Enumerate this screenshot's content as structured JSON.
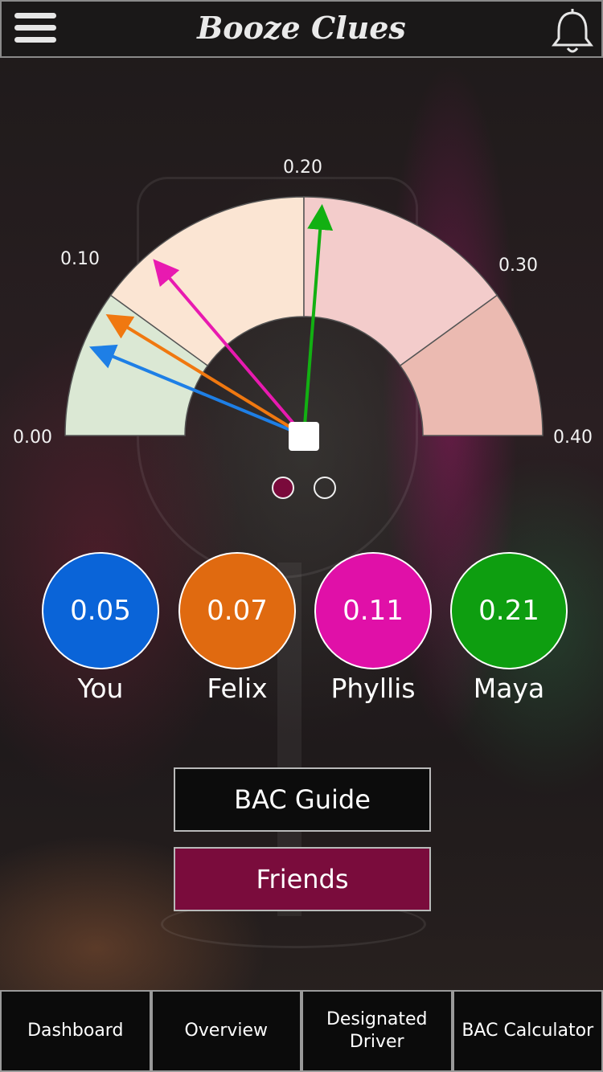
{
  "header": {
    "title": "Booze Clues",
    "menu_icon": "hamburger-menu-icon",
    "bell_icon": "bell-icon"
  },
  "gauge": {
    "ticks": [
      "0.00",
      "0.10",
      "0.20",
      "0.30",
      "0.40"
    ],
    "min": 0.0,
    "max": 0.4,
    "zones": [
      {
        "from": 0.0,
        "to": 0.08,
        "color": "#dbe8d4"
      },
      {
        "from": 0.08,
        "to": 0.2,
        "color": "#fbe5d3"
      },
      {
        "from": 0.2,
        "to": 0.32,
        "color": "#f3cccb"
      },
      {
        "from": 0.32,
        "to": 0.4,
        "color": "#ebbab1"
      }
    ],
    "needles": [
      {
        "value": 0.05,
        "color": "#1e7fe6"
      },
      {
        "value": 0.07,
        "color": "#f07810"
      },
      {
        "value": 0.11,
        "color": "#e81ab0"
      },
      {
        "value": 0.21,
        "color": "#12b012"
      }
    ]
  },
  "pager": {
    "active_color": "#7a0a3b",
    "pages": 2,
    "current": 1
  },
  "friends": [
    {
      "bac": "0.05",
      "name": "You",
      "color": "#0a64d8"
    },
    {
      "bac": "0.07",
      "name": "Felix",
      "color": "#e06a10"
    },
    {
      "bac": "0.11",
      "name": "Phyllis",
      "color": "#e010a8"
    },
    {
      "bac": "0.21",
      "name": "Maya",
      "color": "#0e9e10"
    }
  ],
  "buttons": {
    "guide": "BAC Guide",
    "friends": "Friends"
  },
  "tabs": [
    {
      "label": "Dashboard"
    },
    {
      "label": "Overview"
    },
    {
      "label": "Designated Driver"
    },
    {
      "label": "BAC Calculator"
    }
  ]
}
